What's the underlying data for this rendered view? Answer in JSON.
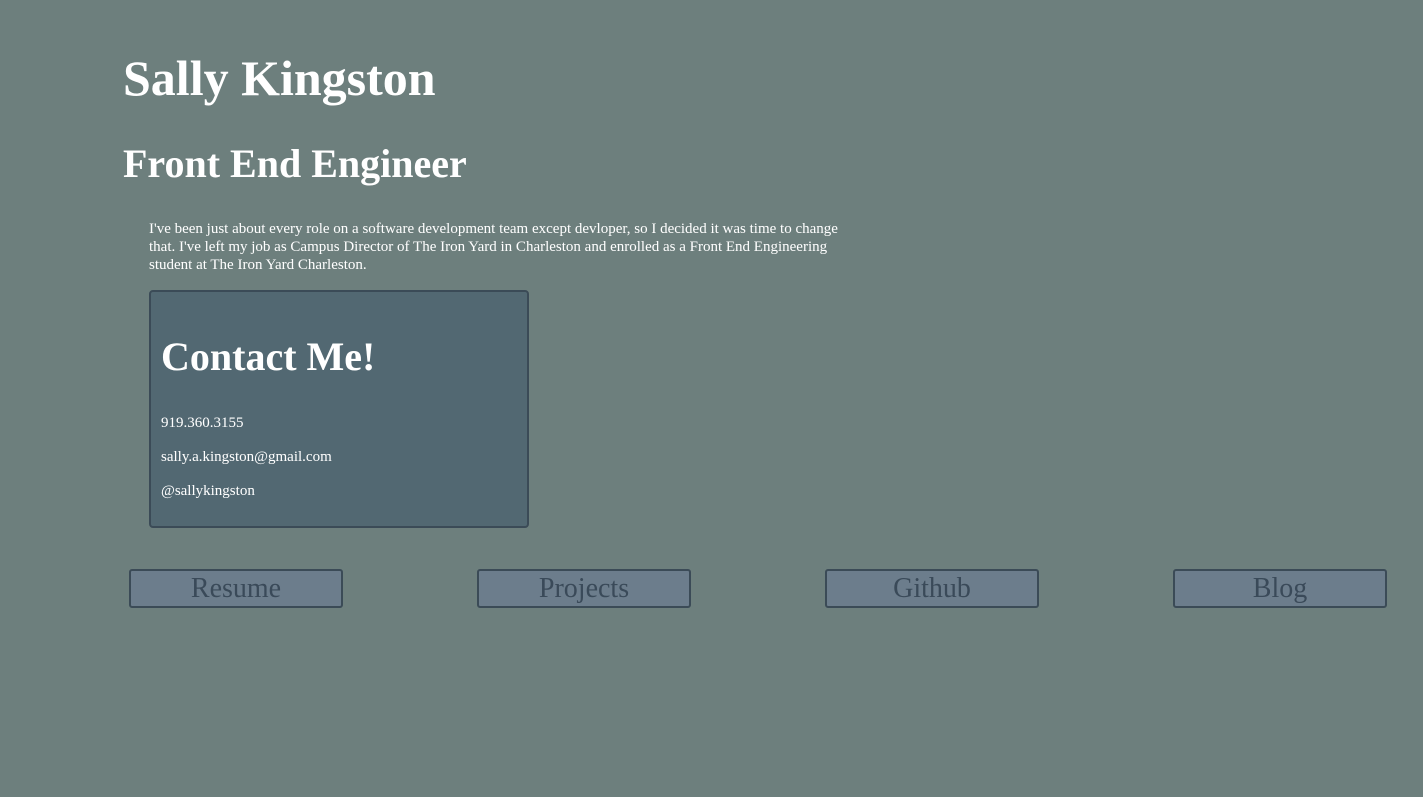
{
  "header": {
    "name": "Sally Kingston",
    "role": "Front End Engineer"
  },
  "bio": "I've been just about every role on a software development team except devloper, so I decided it was time to change that. I've left my job as Campus Director of The Iron Yard in Charleston and enrolled as a Front End Engineering student at The Iron Yard Charleston.",
  "contact": {
    "title": "Contact Me!",
    "phone": "919.360.3155",
    "email": "sally.a.kingston@gmail.com",
    "handle": "@sallykingston"
  },
  "nav": {
    "resume": "Resume",
    "projects": "Projects",
    "github": "Github",
    "blog": "Blog"
  },
  "colors": {
    "background": "#6d7f7d",
    "card": "#526872",
    "button": "#6c7d8c",
    "border": "#3b4b57",
    "button_text": "#3a4a59",
    "text": "#ffffff"
  }
}
